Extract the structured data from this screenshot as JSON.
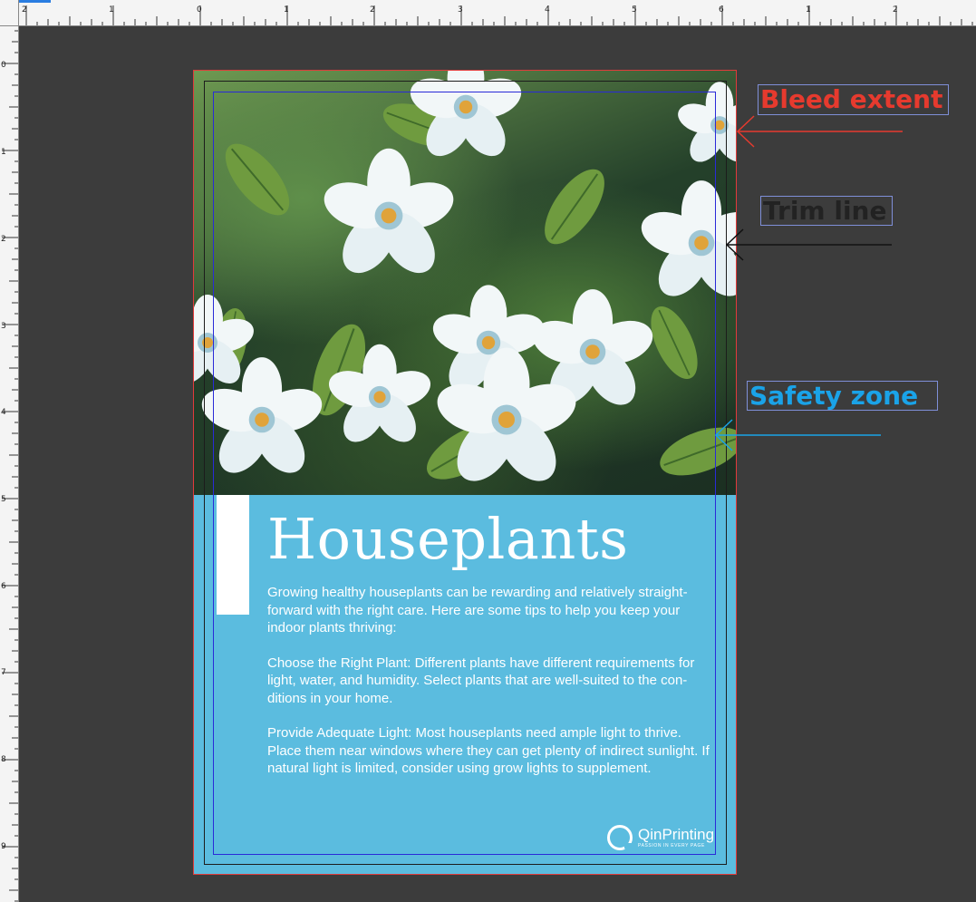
{
  "rulers": {
    "top_labels": [
      "2",
      "1",
      "0",
      "1",
      "2",
      "3",
      "4",
      "5",
      "6",
      "1",
      "2"
    ],
    "left_labels": [
      "0",
      "1",
      "2",
      "3",
      "4",
      "5",
      "6",
      "7",
      "8",
      "9"
    ]
  },
  "document": {
    "headline": "Houseplants",
    "paragraphs": [
      "Growing healthy houseplants can be rewarding and relatively straight-forward with the right care. Here are some tips to help you keep your indoor plants thriving:",
      "Choose the Right Plant: Different plants have different requirements for light, water, and humidity. Select plants that are well-suited to the con-ditions in your home.",
      "Provide Adequate Light: Most houseplants need ample light to thrive. Place them near windows where they can get plenty of indirect sunlight. If natural light is limited, consider using grow lights to supplement."
    ],
    "brand": {
      "name": "QinPrinting",
      "tagline": "PASSION IN EVERY PAGE"
    },
    "photo_subject": "white flowers with green leaves"
  },
  "annotations": {
    "bleed": "Bleed extent",
    "trim": "Trim line",
    "safety": "Safety zone"
  },
  "colors": {
    "canvas": "#3c3c3c",
    "panel": "#5bbcdf",
    "bleed": "#e63a2e",
    "trim": "#222222",
    "safety": "#1aa3e8",
    "safety_guide": "#2a2ad8"
  }
}
